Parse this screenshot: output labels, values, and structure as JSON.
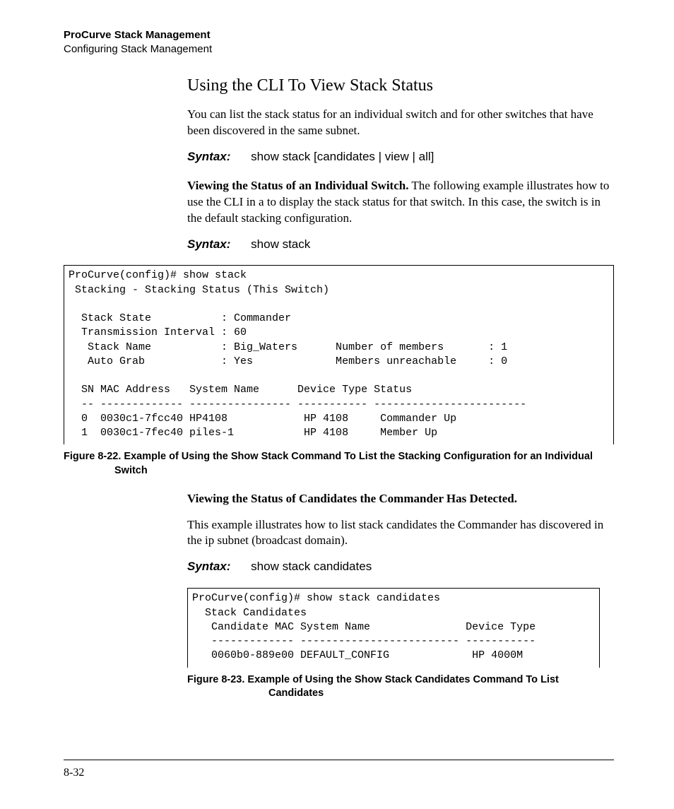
{
  "running_head": {
    "chapter": "ProCurve Stack Management",
    "section": "Configuring Stack Management"
  },
  "title": "Using the CLI To View Stack Status",
  "intro": "You can list the stack status for an individual switch and for other switches that have been discovered in the same subnet.",
  "syntax1": {
    "label": "Syntax:",
    "value": "show stack [candidates | view | all]"
  },
  "heading2_bold": "Viewing the Status of an Individual Switch.",
  "heading2_rest": "  The following example illustrates how to use the CLI in a  to display the stack status for that switch. In this case, the switch is in the default stacking configuration.",
  "syntax2": {
    "label": "Syntax:",
    "value": "show stack"
  },
  "fig22_text": "ProCurve(config)# show stack\n Stacking - Stacking Status (This Switch)\n\n  Stack State           : Commander\n  Transmission Interval : 60\n   Stack Name           : Big_Waters      Number of members       : 1\n   Auto Grab            : Yes             Members unreachable     : 0\n\n  SN MAC Address   System Name      Device Type Status\n  -- ------------- ---------------- ----------- ------------------------\n  0  0030c1-7fcc40 HP4108            HP 4108     Commander Up\n  1  0030c1-7fec40 piles-1           HP 4108     Member Up",
  "fig22_caption": "Figure 8-22. Example of Using the Show Stack Command To List the Stacking Configuration for an Individual Switch",
  "heading3_bold": "Viewing the Status of Candidates the Commander Has Detected.",
  "heading3_body": "This example illustrates how to list stack candidates the Commander has discovered in the ip subnet (broadcast domain).",
  "syntax3": {
    "label": "Syntax:",
    "value": "show stack candidates"
  },
  "fig23_text": "ProCurve(config)# show stack candidates\n  Stack Candidates\n   Candidate MAC System Name               Device Type\n   ------------- ------------------------- -----------\n   0060b0-889e00 DEFAULT_CONFIG             HP 4000M",
  "fig23_caption": "Figure 8-23.  Example of Using the Show Stack Candidates Command To List Candidates",
  "page_number": "8-32"
}
